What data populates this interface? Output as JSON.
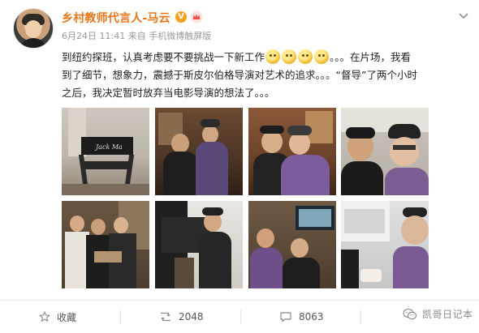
{
  "post": {
    "username": "乡村教师代言人-马云",
    "verified_badge": "V",
    "timestamp": "6月24日 11:41",
    "source": "来自 手机微博触屏版",
    "text_line1_before": "到纽约探班，认真考虑要不要挑战一下新工作",
    "text_line1_after": "。。。在片场，我看",
    "text_line2": "到了细节，想象力，震撼于斯皮尔伯格导演对艺术的追求。。。“督导”了两个小时",
    "text_line3": "之后，我决定暂时放弃当电影导演的想法了。。。",
    "emoji_count": 4,
    "chair_label": "Jack Ma"
  },
  "actions": {
    "favorite_label": "收藏",
    "repost_count": "2048",
    "comment_count": "8063"
  },
  "watermark": "凯哥日记本",
  "colors": {
    "username": "#e7761a",
    "meta": "#999999",
    "verified": "#f3a21c"
  },
  "icons": [
    "star-icon",
    "repost-icon",
    "comment-icon",
    "wechat-icon",
    "chevron-down-icon",
    "verified-icon",
    "crown-badge-icon"
  ]
}
